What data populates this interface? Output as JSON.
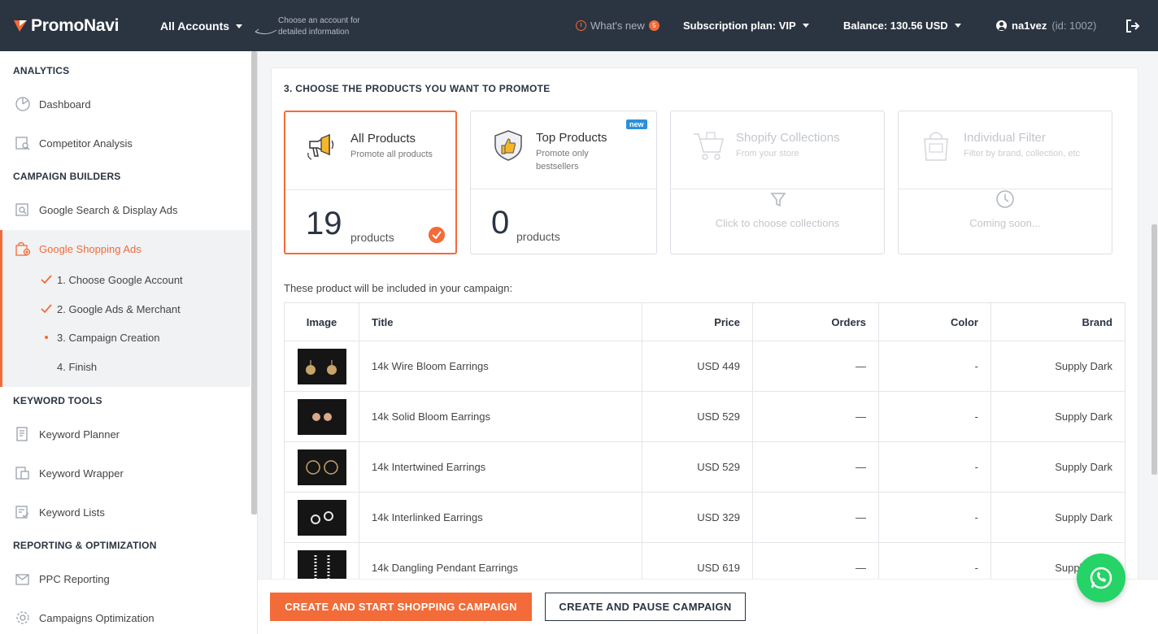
{
  "header": {
    "brand": "PromoNavi",
    "account_select": "All Accounts",
    "account_hint": "Choose an account for detailed information",
    "whats_new": "What's new",
    "whats_new_count": "5",
    "subscription": "Subscription plan: VIP",
    "balance": "Balance: 130.56 USD",
    "username": "na1vez",
    "user_id": "(id: 1002)"
  },
  "sidebar": {
    "analytics": "ANALYTICS",
    "dashboard": "Dashboard",
    "competitor": "Competitor Analysis",
    "campaign_builders": "CAMPAIGN BUILDERS",
    "google_search": "Google Search & Display Ads",
    "google_shopping": "Google Shopping Ads",
    "steps": [
      "1. Choose Google Account",
      "2. Google Ads & Merchant",
      "3. Campaign Creation",
      "4. Finish"
    ],
    "keyword_tools": "KEYWORD TOOLS",
    "keyword_planner": "Keyword Planner",
    "keyword_wrapper": "Keyword Wrapper",
    "keyword_lists": "Keyword Lists",
    "reporting": "REPORTING & OPTIMIZATION",
    "ppc_reporting": "PPC Reporting",
    "campaigns_optimization": "Campaigns Optimization"
  },
  "main": {
    "step_title": "3. CHOOSE THE PRODUCTS YOU WANT TO PROMOTE",
    "cards": {
      "all": {
        "title": "All Products",
        "subtitle": "Promote all products",
        "count": "19",
        "count_label": "products"
      },
      "top": {
        "title": "Top Products",
        "subtitle": "Promote only bestsellers",
        "badge": "new",
        "count": "0",
        "count_label": "products"
      },
      "shopify": {
        "title": "Shopify Collections",
        "subtitle": "From your store",
        "action": "Click to choose collections"
      },
      "individual": {
        "title": "Individual Filter",
        "subtitle": "Filter by brand, collection, etc",
        "action": "Coming soon..."
      }
    },
    "included_text": "These product will be included in your campaign:",
    "table": {
      "headers": [
        "Image",
        "Title",
        "Price",
        "Orders",
        "Color",
        "Brand"
      ],
      "rows": [
        {
          "title": "14k Wire Bloom Earrings",
          "price": "USD 449",
          "orders": "—",
          "color": "-",
          "brand": "Supply Dark"
        },
        {
          "title": "14k Solid Bloom Earrings",
          "price": "USD 529",
          "orders": "—",
          "color": "-",
          "brand": "Supply Dark"
        },
        {
          "title": "14k Intertwined Earrings",
          "price": "USD 529",
          "orders": "—",
          "color": "-",
          "brand": "Supply Dark"
        },
        {
          "title": "14k Interlinked Earrings",
          "price": "USD 329",
          "orders": "—",
          "color": "-",
          "brand": "Supply Dark"
        },
        {
          "title": "14k Dangling Pendant Earrings",
          "price": "USD 619",
          "orders": "—",
          "color": "-",
          "brand": "Supply Dark"
        }
      ]
    },
    "buttons": {
      "primary": "CREATE AND START SHOPPING CAMPAIGN",
      "secondary": "CREATE AND PAUSE CAMPAIGN"
    }
  },
  "colors": {
    "accent": "#f26b38",
    "topbar": "#2b3441",
    "badge": "#2d8fd9",
    "whatsapp": "#25d366"
  }
}
